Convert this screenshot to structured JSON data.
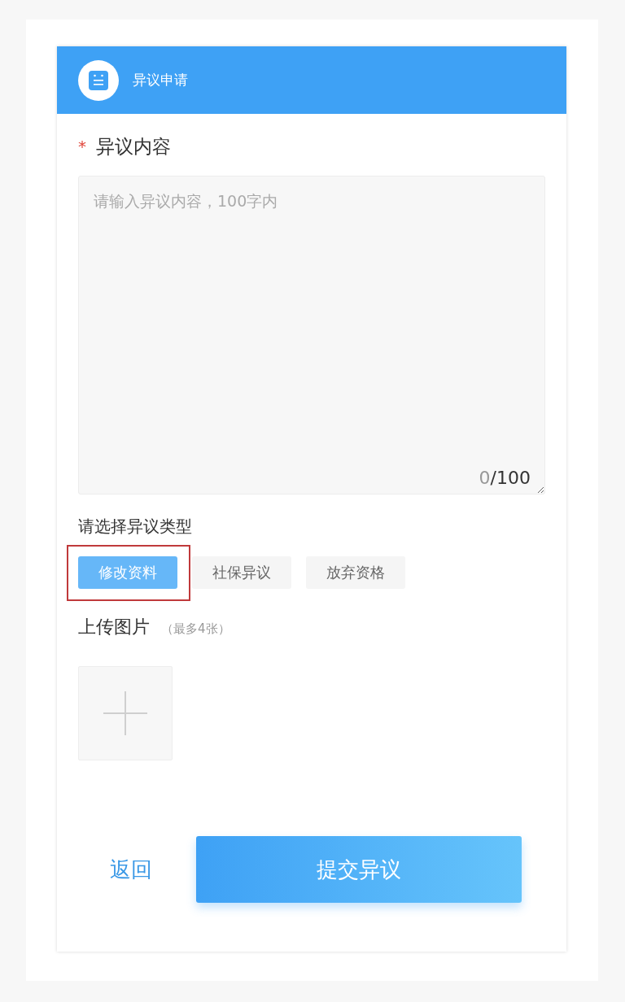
{
  "header": {
    "title": "异议申请"
  },
  "content": {
    "required_mark": "*",
    "label": "异议内容",
    "placeholder": "请输入异议内容，100字内",
    "count": "0",
    "limit": "/100"
  },
  "type_section": {
    "label": "请选择异议类型",
    "options": [
      {
        "label": "修改资料",
        "selected": true,
        "highlighted": true
      },
      {
        "label": "社保异议",
        "selected": false,
        "highlighted": false
      },
      {
        "label": "放弃资格",
        "selected": false,
        "highlighted": false
      }
    ]
  },
  "upload": {
    "label": "上传图片",
    "hint": "（最多4张）"
  },
  "actions": {
    "back": "返回",
    "submit": "提交异议"
  }
}
